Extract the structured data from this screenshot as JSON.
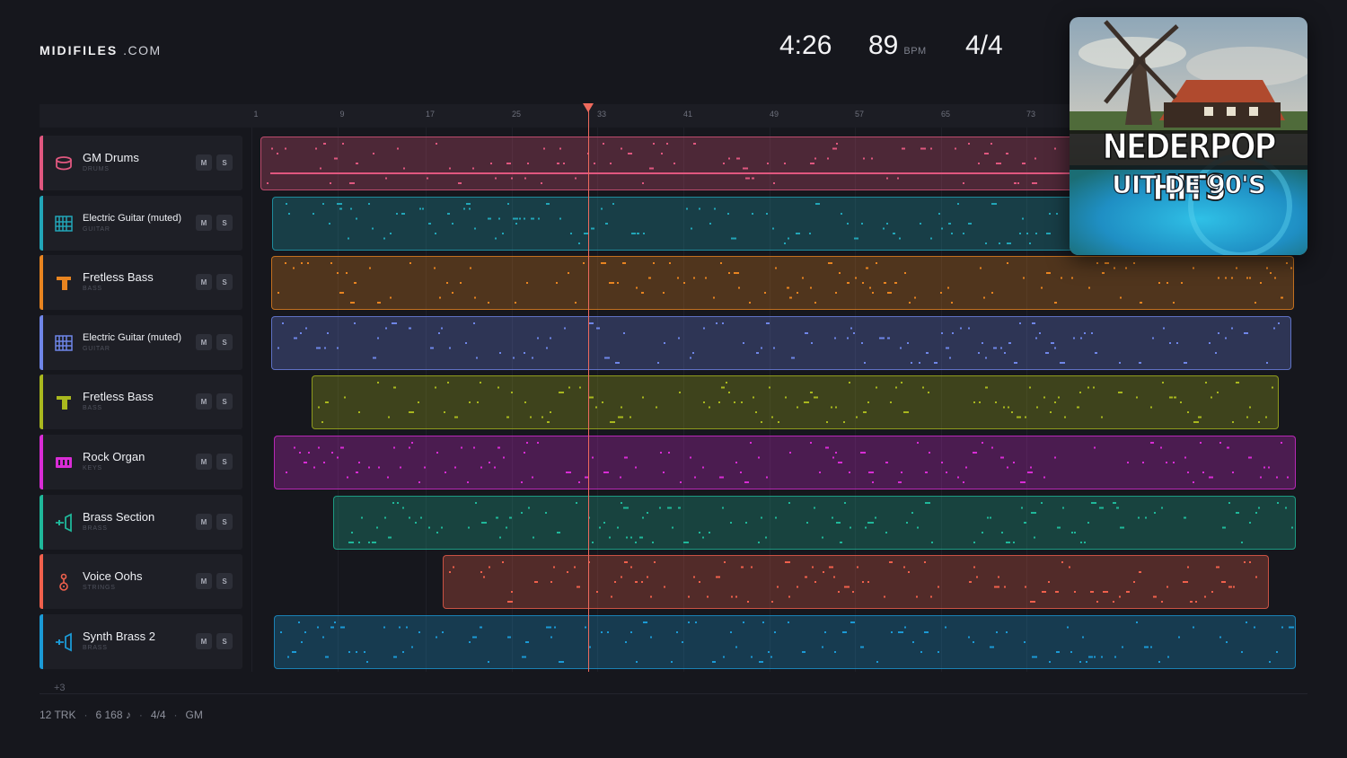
{
  "brand": {
    "name_bold": "MIDIFILES",
    "name_suffix": ".COM"
  },
  "transport": {
    "time": "4:26",
    "bpm": "89",
    "bpm_unit": "BPM",
    "signature": "4/4"
  },
  "ruler": {
    "bars": [
      "1",
      "9",
      "17",
      "25",
      "33",
      "41",
      "49",
      "57",
      "65",
      "73"
    ]
  },
  "tracks": [
    {
      "name": "GM Drums",
      "category": "DRUMS",
      "color": "#e0577f",
      "icon": "drum-icon",
      "mute": "M",
      "solo": "S"
    },
    {
      "name": "Electric Guitar (muted)",
      "category": "GUITAR",
      "color": "#22a6b8",
      "icon": "guitar-grid-icon",
      "mute": "M",
      "solo": "S"
    },
    {
      "name": "Fretless Bass",
      "category": "BASS",
      "color": "#e88420",
      "icon": "bass-icon",
      "mute": "M",
      "solo": "S"
    },
    {
      "name": "Electric Guitar (muted)",
      "category": "GUITAR",
      "color": "#6f86e8",
      "icon": "guitar-grid-icon",
      "mute": "M",
      "solo": "S"
    },
    {
      "name": "Fretless Bass",
      "category": "BASS",
      "color": "#a9b81e",
      "icon": "bass-icon",
      "mute": "M",
      "solo": "S"
    },
    {
      "name": "Rock Organ",
      "category": "KEYS",
      "color": "#d92cd6",
      "icon": "keyboard-icon",
      "mute": "M",
      "solo": "S"
    },
    {
      "name": "Brass Section",
      "category": "BRASS",
      "color": "#1fb89a",
      "icon": "trumpet-icon",
      "mute": "M",
      "solo": "S"
    },
    {
      "name": "Voice Oohs",
      "category": "STRINGS",
      "color": "#f0604c",
      "icon": "voice-icon",
      "mute": "M",
      "solo": "S"
    },
    {
      "name": "Synth Brass 2",
      "category": "BRASS",
      "color": "#1b9ad6",
      "icon": "trumpet-icon",
      "mute": "M",
      "solo": "S"
    }
  ],
  "more_tracks": "+3",
  "footer": {
    "tracks": "12 TRK",
    "notes": "6 168 ♪",
    "signature": "4/4",
    "standard": "GM"
  },
  "album": {
    "title": "NEDERPOP HITS",
    "subtitle": "UIT DE 90'S"
  }
}
